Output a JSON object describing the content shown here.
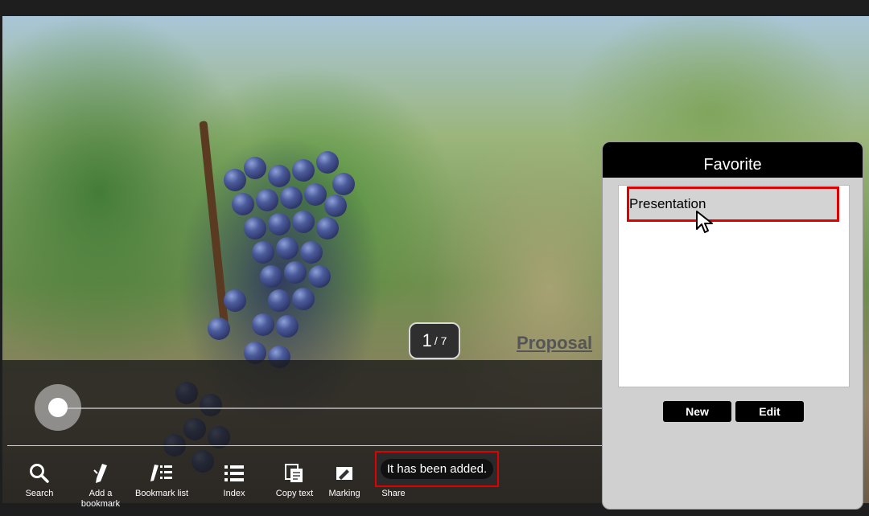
{
  "viewer": {
    "page_current": "1",
    "page_total": "/ 7",
    "slide_title": "Proposal"
  },
  "toolbar": {
    "items": [
      {
        "label": "Search",
        "icon": "search-icon"
      },
      {
        "label": "Add a bookmark",
        "icon": "bookmark-add-icon"
      },
      {
        "label": "Bookmark list",
        "icon": "bookmark-list-icon"
      },
      {
        "label": "Index",
        "icon": "index-icon"
      },
      {
        "label": "Copy text",
        "icon": "copy-text-icon"
      },
      {
        "label": "Marking",
        "icon": "marking-icon"
      },
      {
        "label": "Share",
        "icon": "share-icon"
      }
    ]
  },
  "toast": {
    "message": "It has been added."
  },
  "favorite": {
    "title": "Favorite",
    "items": [
      {
        "label": "Presentation"
      }
    ],
    "new_label": "New",
    "edit_label": "Edit"
  },
  "colors": {
    "highlight": "#e00000",
    "panel_bg": "#d0d0d0",
    "header_bg": "#000000"
  }
}
